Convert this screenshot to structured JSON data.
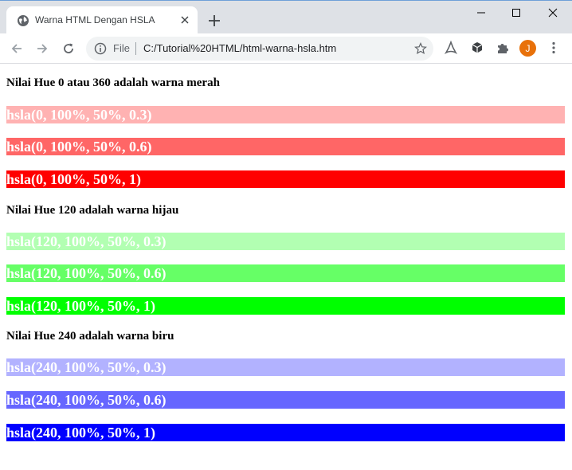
{
  "browser": {
    "tab_title": "Warna HTML Dengan HSLA",
    "scheme_label": "File",
    "url": "C:/Tutorial%20HTML/html-warna-hsla.htm",
    "avatar_initial": "J",
    "icons": [
      "globe-icon",
      "close-icon",
      "plus-icon",
      "minimize-icon",
      "maximize-icon",
      "back-icon",
      "forward-icon",
      "reload-icon",
      "info-icon",
      "star-icon",
      "pdf-extension-icon",
      "cube-extension-icon",
      "puzzle-icon",
      "more-icon"
    ]
  },
  "sections": [
    {
      "heading": "Nilai Hue 0 atau 360 adalah warna merah",
      "swatches": [
        {
          "label": "hsla(0, 100%, 50%, 0.3)",
          "color": "hsla(0, 100%, 50%, 0.3)"
        },
        {
          "label": "hsla(0, 100%, 50%, 0.6)",
          "color": "hsla(0, 100%, 50%, 0.6)"
        },
        {
          "label": "hsla(0, 100%, 50%, 1)",
          "color": "hsla(0, 100%, 50%, 1)"
        }
      ]
    },
    {
      "heading": "Nilai Hue 120 adalah warna hijau",
      "swatches": [
        {
          "label": "hsla(120, 100%, 50%, 0.3)",
          "color": "hsla(120, 100%, 50%, 0.3)"
        },
        {
          "label": "hsla(120, 100%, 50%, 0.6)",
          "color": "hsla(120, 100%, 50%, 0.6)"
        },
        {
          "label": "hsla(120, 100%, 50%, 1)",
          "color": "hsla(120, 100%, 50%, 1)"
        }
      ]
    },
    {
      "heading": "Nilai Hue 240 adalah warna biru",
      "swatches": [
        {
          "label": "hsla(240, 100%, 50%, 0.3)",
          "color": "hsla(240, 100%, 50%, 0.3)"
        },
        {
          "label": "hsla(240, 100%, 50%, 0.6)",
          "color": "hsla(240, 100%, 50%, 0.6)"
        },
        {
          "label": "hsla(240, 100%, 50%, 1)",
          "color": "hsla(240, 100%, 50%, 1)"
        }
      ]
    }
  ]
}
